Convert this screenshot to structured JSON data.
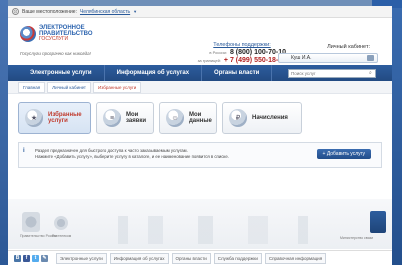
{
  "location": {
    "label": "Ваше местоположение:",
    "city": "Челябинская область"
  },
  "logo": {
    "line1": "ЭЛЕКТРОННОЕ",
    "line2": "ПРАВИТЕЛЬСТВО",
    "line3": "ГОСУСЛУГИ",
    "tagline": "Госуслуги прозрачно как никогда!"
  },
  "phones": {
    "title": "Телефоны поддержки:",
    "rows": [
      {
        "where": "в России:",
        "number": "8 (800) 100-70-10"
      },
      {
        "where": "за границей:",
        "number": "+ 7 (499) 550-18-39"
      }
    ]
  },
  "cabinet": {
    "title": "Личный кабинет:",
    "user": "Куш И.А."
  },
  "nav": {
    "items": [
      "Электронные услуги",
      "Информация об услугах",
      "Органы власти"
    ],
    "search_placeholder": "Поиск услуг"
  },
  "breadcrumbs": [
    "Главная",
    "Личный кабинет",
    "Избранные услуги"
  ],
  "tabs": [
    {
      "line1": "Избранные",
      "line2": "услуги",
      "icon": "star-icon",
      "active": true
    },
    {
      "line1": "Мои",
      "line2": "заявки",
      "icon": "requests-icon",
      "active": false
    },
    {
      "line1": "Мои",
      "line2": "данные",
      "icon": "user-data-icon",
      "active": false
    },
    {
      "line1": "Начисления",
      "line2": "",
      "icon": "charges-icon",
      "active": false
    }
  ],
  "info": {
    "text1": "Раздел предназначен для быстрого доступа к часто заказываемым услугам.",
    "text2": "Нажмите «Добавить услугу», выберите услугу в каталоге, и ее наименование появится в списке.",
    "add_button": "+ Добавить услугу"
  },
  "footer": {
    "captions": [
      "Правительство России",
      "Ростелеком",
      "Министерство связи"
    ],
    "links": [
      "Электронные услуги",
      "Информация об услугах",
      "Органы власти",
      "Служба поддержки",
      "Справочная информация"
    ]
  },
  "colors": {
    "nav": "#2d5d9e",
    "accent_red": "#c0392b",
    "link": "#2a5a9a"
  }
}
